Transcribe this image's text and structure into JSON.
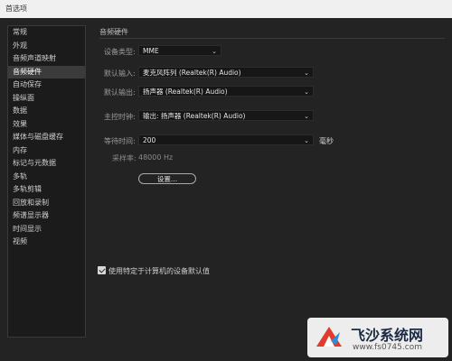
{
  "window": {
    "title": "首选项"
  },
  "sidebar": {
    "items": [
      {
        "label": "常规"
      },
      {
        "label": "外观"
      },
      {
        "label": "音频声道映射"
      },
      {
        "label": "音频硬件",
        "active": true
      },
      {
        "label": "自动保存"
      },
      {
        "label": "操纵面"
      },
      {
        "label": "数据"
      },
      {
        "label": "效果"
      },
      {
        "label": "媒体与磁盘缓存"
      },
      {
        "label": "内存"
      },
      {
        "label": "标记与元数据"
      },
      {
        "label": "多轨"
      },
      {
        "label": "多轨剪辑"
      },
      {
        "label": "回放和录制"
      },
      {
        "label": "频谱显示器"
      },
      {
        "label": "时间显示"
      },
      {
        "label": "视频"
      }
    ]
  },
  "main": {
    "section_title": "音频硬件",
    "device_type": {
      "label": "设备类型:",
      "value": "MME"
    },
    "default_input": {
      "label": "默认输入:",
      "value": "麦克风阵列 (Realtek(R) Audio)"
    },
    "default_output": {
      "label": "默认输出:",
      "value": "扬声器 (Realtek(R) Audio)"
    },
    "master_clock": {
      "label": "主控时钟:",
      "value": "输出: 扬声器 (Realtek(R) Audio)"
    },
    "latency": {
      "label": "等待时间:",
      "value": "200",
      "unit": "毫秒"
    },
    "sample_rate": {
      "label": "采样率:",
      "value": "48000 Hz"
    },
    "settings_button": "设置...",
    "use_defaults": {
      "label": "使用特定于计算机的设备默认值",
      "checked": true
    }
  },
  "watermark": {
    "name": "飞沙系统网",
    "url": "www.fs0745.com"
  }
}
